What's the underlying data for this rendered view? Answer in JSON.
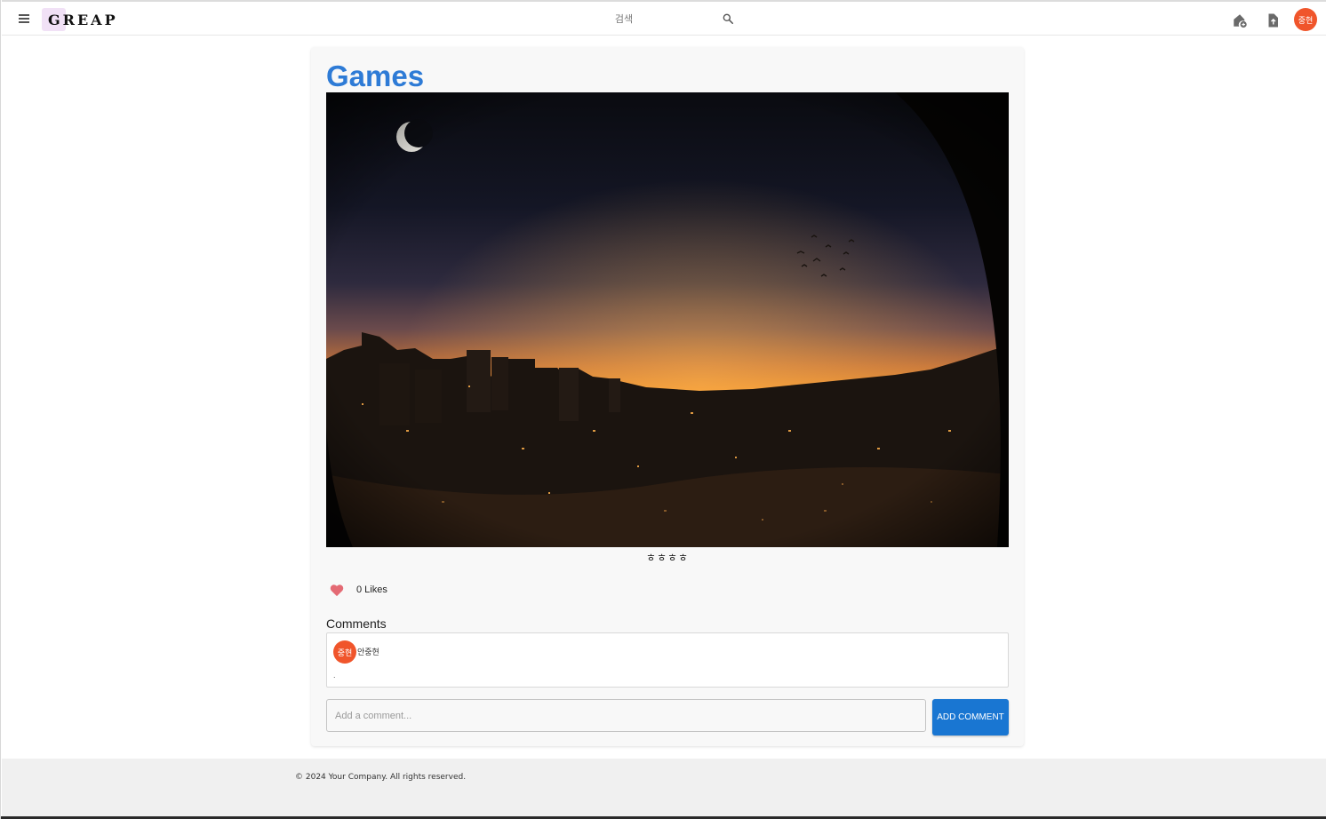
{
  "header": {
    "logo_text": "GREAP",
    "search_placeholder": "검색",
    "user_initials": "중현",
    "icons": [
      "menu-icon",
      "search-icon",
      "home-add-icon",
      "upload-file-icon"
    ]
  },
  "post": {
    "title": "Games",
    "image_alt": "Sunset city skyline viewed through a fisheye lens with a crescent moon and birds",
    "caption": "ㅎㅎㅎㅎ",
    "likes_text": "0 Likes"
  },
  "comments": {
    "label": "Comments",
    "items": [
      {
        "initials": "중현",
        "author": "안중현",
        "text": "."
      }
    ],
    "input_placeholder": "Add a comment...",
    "add_button_label": "ADD COMMENT"
  },
  "footer": {
    "copyright": "© 2024 Your Company. All rights reserved."
  },
  "colors": {
    "accent": "#1976d2",
    "title": "#2e7bd6",
    "avatar": "#f0552b",
    "heart": "#e46a74"
  }
}
